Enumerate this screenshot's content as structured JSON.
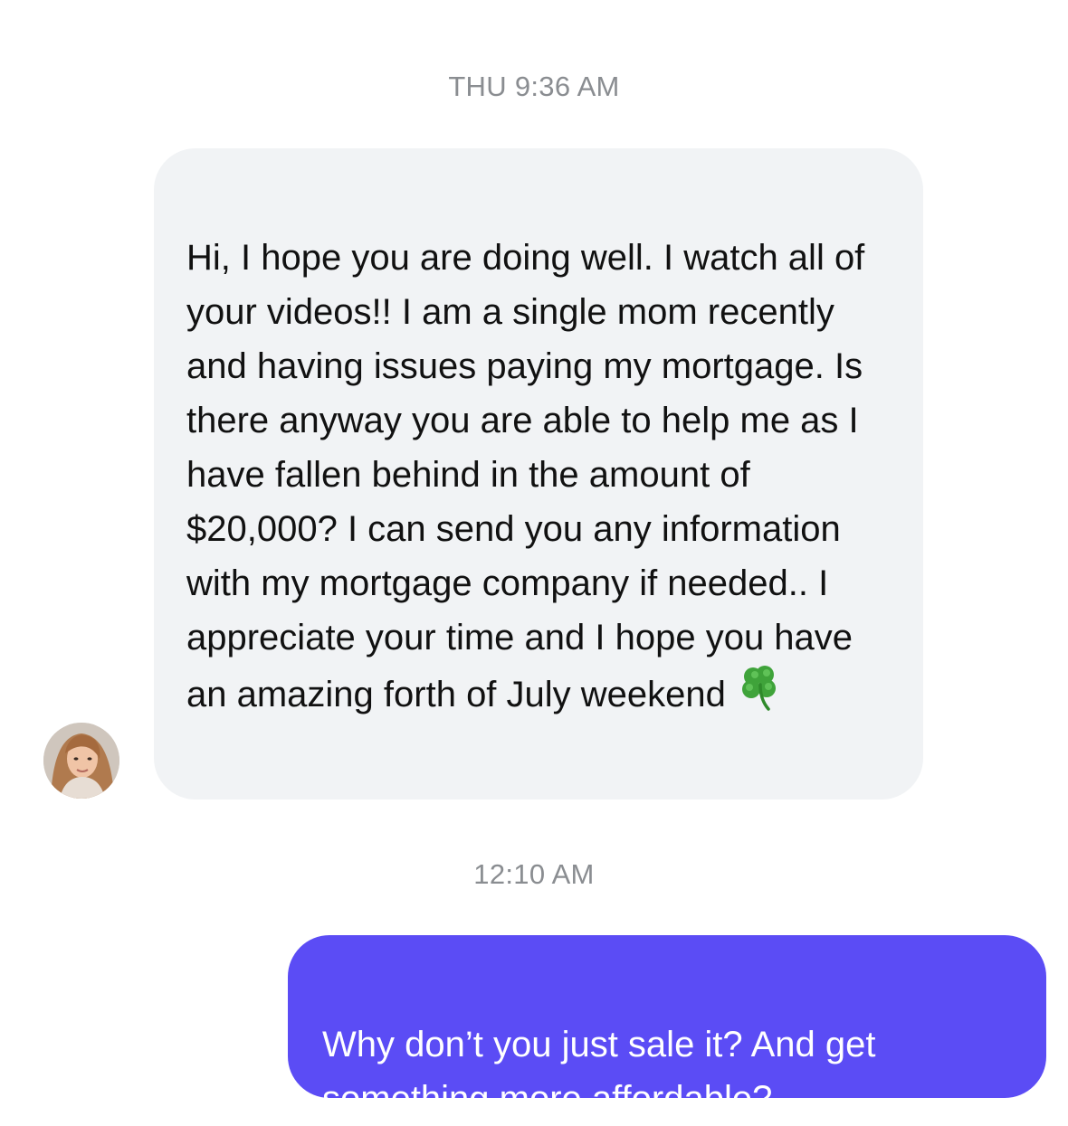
{
  "conversation": {
    "messages": [
      {
        "timestamp": "THU 9:36 AM",
        "direction": "incoming",
        "text": "Hi, I hope you are doing well.  I watch all of your videos!! I am a single mom recently and having issues paying my mortgage.  Is there anyway you are able to help me as I have fallen behind in the amount of $20,000? I can send you any information with my mortgage company if needed.. I appreciate your time and I hope you have an amazing forth of July weekend",
        "emoji": "four-leaf-clover-icon",
        "avatar": "sender-avatar"
      },
      {
        "timestamp": "12:10 AM",
        "direction": "outgoing",
        "text": "Why don’t you just sale it? And get something more affordable?"
      }
    ]
  },
  "colors": {
    "incoming_bubble": "#f1f3f5",
    "outgoing_bubble": "#5b4cf5",
    "timestamp_text": "#8a8d91"
  }
}
